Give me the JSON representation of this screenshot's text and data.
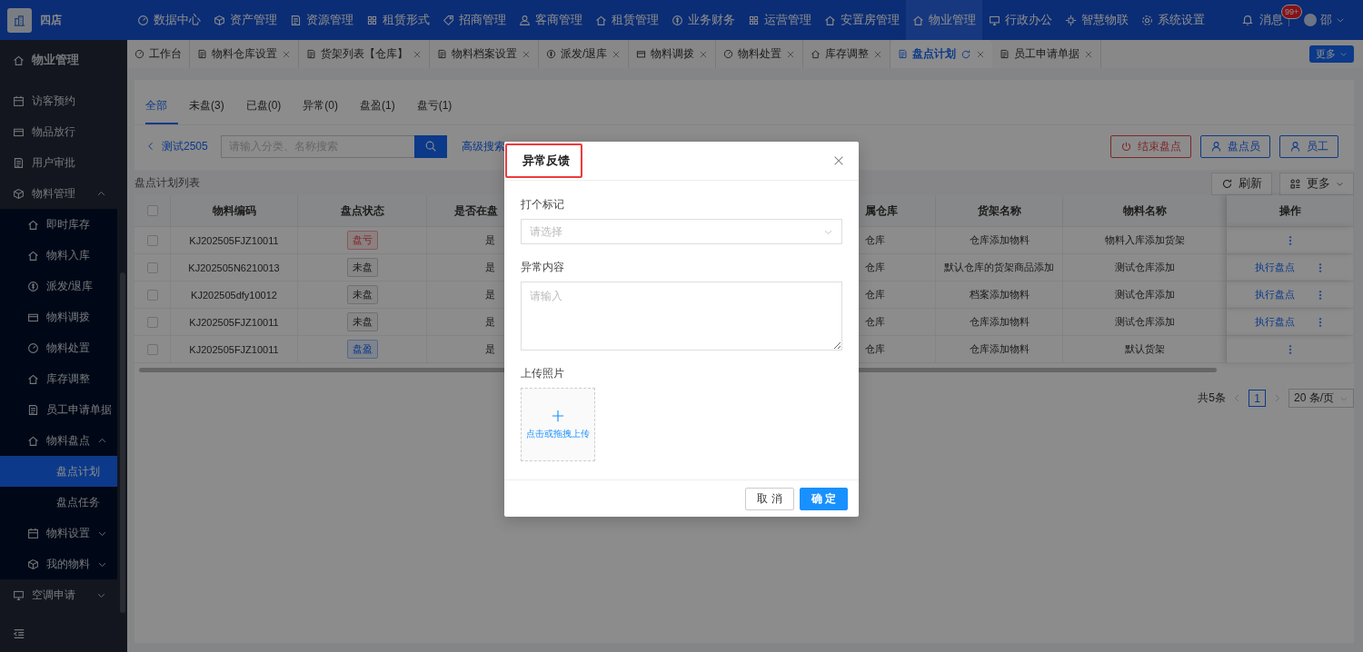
{
  "topbar": {
    "logo_text": "四店",
    "nav": [
      {
        "label": "数据中心",
        "selected": false
      },
      {
        "label": "资产管理",
        "selected": false
      },
      {
        "label": "资源管理",
        "selected": false
      },
      {
        "label": "租赁形式",
        "selected": false
      },
      {
        "label": "招商管理",
        "selected": false
      },
      {
        "label": "客商管理",
        "selected": false
      },
      {
        "label": "租赁管理",
        "selected": false
      },
      {
        "label": "业务财务",
        "selected": false
      },
      {
        "label": "运营管理",
        "selected": false
      },
      {
        "label": "安置房管理",
        "selected": false
      },
      {
        "label": "物业管理",
        "selected": true
      },
      {
        "label": "行政办公",
        "selected": false
      },
      {
        "label": "智慧物联",
        "selected": false
      },
      {
        "label": "系统设置",
        "selected": false
      }
    ],
    "messages": {
      "label": "消息",
      "badge": "99+"
    },
    "user": {
      "name": "邵"
    }
  },
  "tabs": [
    {
      "label": "工作台",
      "selected": false,
      "closable": false
    },
    {
      "label": "物料仓库设置",
      "selected": false,
      "closable": true
    },
    {
      "label": "货架列表【仓库】",
      "selected": false,
      "closable": true
    },
    {
      "label": "物料档案设置",
      "selected": false,
      "closable": true
    },
    {
      "label": "派发/退库",
      "selected": false,
      "closable": true
    },
    {
      "label": "物料调拨",
      "selected": false,
      "closable": true
    },
    {
      "label": "物料处置",
      "selected": false,
      "closable": true
    },
    {
      "label": "库存调整",
      "selected": false,
      "closable": true
    },
    {
      "label": "盘点计划",
      "selected": true,
      "closable": true
    },
    {
      "label": "员工申请单据",
      "selected": false,
      "closable": true
    }
  ],
  "tabs_more": "更多",
  "sidebar": {
    "title": "物业管理",
    "items": [
      {
        "label": "访客预约",
        "kind": "link",
        "selected": false
      },
      {
        "label": "物品放行",
        "kind": "link",
        "selected": false
      },
      {
        "label": "用户审批",
        "kind": "link",
        "selected": false
      },
      {
        "label": "物料管理",
        "kind": "group",
        "expanded": true,
        "selected": false,
        "children": [
          {
            "label": "即时库存",
            "kind": "link",
            "selected": false
          },
          {
            "label": "物料入库",
            "kind": "link",
            "selected": false
          },
          {
            "label": "派发/退库",
            "kind": "link",
            "selected": false
          },
          {
            "label": "物料调拨",
            "kind": "link",
            "selected": false
          },
          {
            "label": "物料处置",
            "kind": "link",
            "selected": false
          },
          {
            "label": "库存调整",
            "kind": "link",
            "selected": false
          },
          {
            "label": "员工申请单据",
            "kind": "link",
            "selected": false
          },
          {
            "label": "物料盘点",
            "kind": "group",
            "expanded": true,
            "selected": false,
            "children": [
              {
                "label": "盘点计划",
                "kind": "link",
                "selected": true
              },
              {
                "label": "盘点任务",
                "kind": "link",
                "selected": false
              }
            ]
          },
          {
            "label": "物料设置",
            "kind": "group",
            "expanded": false,
            "selected": false
          },
          {
            "label": "我的物料",
            "kind": "group",
            "expanded": false,
            "selected": false
          }
        ]
      },
      {
        "label": "空调申请",
        "kind": "group",
        "expanded": false,
        "selected": false
      }
    ]
  },
  "status_tabs": [
    {
      "label": "全部",
      "selected": true
    },
    {
      "label": "未盘(3)",
      "selected": false
    },
    {
      "label": "已盘(0)",
      "selected": false
    },
    {
      "label": "异常(0)",
      "selected": false
    },
    {
      "label": "盘盈(1)",
      "selected": false
    },
    {
      "label": "盘亏(1)",
      "selected": false
    }
  ],
  "plan_name": "测试2505",
  "search": {
    "placeholder": "请输入分类、名称搜索"
  },
  "advanced_search": "高级搜索",
  "actions": [
    {
      "label": "结束盘点",
      "kind": "danger"
    },
    {
      "label": "盘点员",
      "kind": "primary"
    },
    {
      "label": "员工",
      "kind": "primary"
    }
  ],
  "table": {
    "title": "盘点计划列表",
    "refresh": "刷新",
    "more": "更多",
    "select_all_checked": false,
    "columns": [
      "物料编码",
      "盘点状态",
      "是否在盘",
      "属仓库",
      "货架名称",
      "物料名称",
      "操作"
    ],
    "rows": [
      {
        "checked": false,
        "code": "KJ202505FJZ10011",
        "status": "盘亏",
        "kind": "loss",
        "counting": "是",
        "warehouse": "仓库",
        "shelf": "仓库添加物料",
        "material": "物料入库添加货架"
      },
      {
        "checked": false,
        "code": "KJ202505N6210013",
        "status": "未盘",
        "kind": "pending",
        "counting": "是",
        "warehouse": "仓库",
        "shelf": "默认仓库的货架商品添加",
        "material": "测试仓库添加",
        "action": "执行盘点"
      },
      {
        "checked": false,
        "code": "KJ202505dfy10012",
        "status": "未盘",
        "kind": "pending",
        "counting": "是",
        "warehouse": "仓库",
        "shelf": "档案添加物料",
        "material": "测试仓库添加",
        "action": "执行盘点"
      },
      {
        "checked": false,
        "code": "KJ202505FJZ10011",
        "status": "未盘",
        "kind": "pending",
        "counting": "是",
        "warehouse": "仓库",
        "shelf": "仓库添加物料",
        "material": "测试仓库添加",
        "action": "执行盘点"
      },
      {
        "checked": false,
        "code": "KJ202505FJZ10011",
        "status": "盘盈",
        "kind": "gain",
        "counting": "是",
        "warehouse": "仓库",
        "shelf": "仓库添加物料",
        "material": "默认货架"
      }
    ]
  },
  "pagination": {
    "total": "共5条",
    "pages": [
      {
        "label": "1",
        "selected": true
      }
    ],
    "page_size": "20 条/页"
  },
  "dialog": {
    "title": "异常反馈",
    "mark": {
      "label": "打个标记",
      "placeholder": "请选择"
    },
    "content": {
      "label": "异常内容",
      "placeholder": "请输入"
    },
    "photo": {
      "label": "上传照片",
      "hint": "点击或拖拽上传"
    },
    "cancel": "取 消",
    "confirm": "确 定"
  }
}
